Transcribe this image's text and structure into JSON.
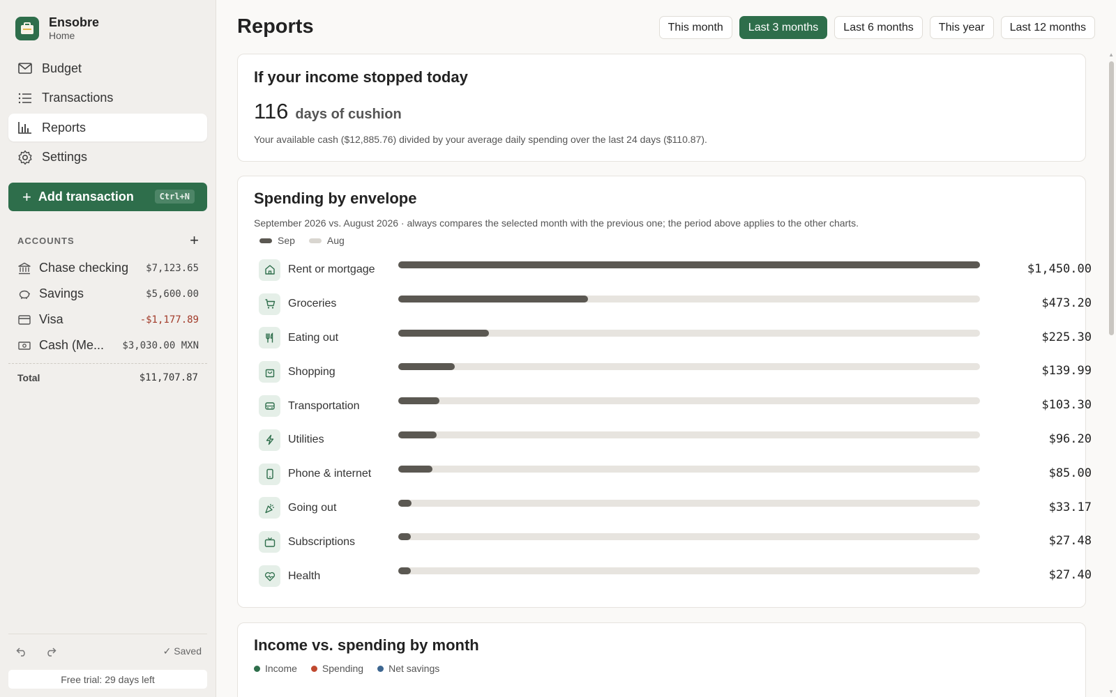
{
  "app": {
    "name": "Ensobre",
    "subtitle": "Home"
  },
  "nav": [
    {
      "label": "Budget",
      "icon": "envelope-icon",
      "active": false
    },
    {
      "label": "Transactions",
      "icon": "list-icon",
      "active": false
    },
    {
      "label": "Reports",
      "icon": "bar-chart-icon",
      "active": true
    },
    {
      "label": "Settings",
      "icon": "gear-icon",
      "active": false
    }
  ],
  "add_transaction": {
    "label": "Add transaction",
    "shortcut": "Ctrl+N"
  },
  "accounts": {
    "title": "ACCOUNTS",
    "items": [
      {
        "name": "Chase checking",
        "value": "$7,123.65",
        "icon": "bank-icon",
        "negative": false
      },
      {
        "name": "Savings",
        "value": "$5,600.00",
        "icon": "piggy-bank-icon",
        "negative": false
      },
      {
        "name": "Visa",
        "value": "-$1,177.89",
        "icon": "credit-card-icon",
        "negative": true
      },
      {
        "name": "Cash (Me...",
        "value": "$3,030.00 MXN",
        "icon": "cash-icon",
        "negative": false
      }
    ],
    "total_label": "Total",
    "total_value": "$11,707.87"
  },
  "footer": {
    "saved": "✓ Saved",
    "trial": "Free trial: 29 days left"
  },
  "page": {
    "title": "Reports"
  },
  "ranges": [
    {
      "label": "This month",
      "active": false
    },
    {
      "label": "Last 3 months",
      "active": true
    },
    {
      "label": "Last 6 months",
      "active": false
    },
    {
      "label": "This year",
      "active": false
    },
    {
      "label": "Last 12 months",
      "active": false
    }
  ],
  "cushion": {
    "title": "If your income stopped today",
    "days": "116",
    "days_label": "days of cushion",
    "note": "Your available cash ($12,885.76) divided by your average daily spending over the last 24 days ($110.87)."
  },
  "spending": {
    "title": "Spending by envelope",
    "subtitle": "September 2026 vs. August 2026 · always compares the selected month with the previous one; the period above applies to the other charts.",
    "legend": [
      {
        "label": "Sep",
        "color": "#5b5852"
      },
      {
        "label": "Aug",
        "color": "#d9d6d0"
      }
    ],
    "envelopes": [
      {
        "name": "Rent or mortgage",
        "amount": "$1,450.00",
        "value": 1450.0,
        "icon": "home-icon"
      },
      {
        "name": "Groceries",
        "amount": "$473.20",
        "value": 473.2,
        "icon": "cart-icon"
      },
      {
        "name": "Eating out",
        "amount": "$225.30",
        "value": 225.3,
        "icon": "utensils-icon"
      },
      {
        "name": "Shopping",
        "amount": "$139.99",
        "value": 139.99,
        "icon": "shopping-bag-icon"
      },
      {
        "name": "Transportation",
        "amount": "$103.30",
        "value": 103.3,
        "icon": "bus-icon"
      },
      {
        "name": "Utilities",
        "amount": "$96.20",
        "value": 96.2,
        "icon": "bolt-icon"
      },
      {
        "name": "Phone & internet",
        "amount": "$85.00",
        "value": 85.0,
        "icon": "phone-icon"
      },
      {
        "name": "Going out",
        "amount": "$33.17",
        "value": 33.17,
        "icon": "party-icon"
      },
      {
        "name": "Subscriptions",
        "amount": "$27.48",
        "value": 27.48,
        "icon": "tv-icon"
      },
      {
        "name": "Health",
        "amount": "$27.40",
        "value": 27.4,
        "icon": "heart-pulse-icon"
      }
    ],
    "max": 1450.0
  },
  "income_chart": {
    "title": "Income vs. spending by month",
    "legend": [
      {
        "label": "Income",
        "color": "#2e6e4b"
      },
      {
        "label": "Spending",
        "color": "#c0492f"
      },
      {
        "label": "Net savings",
        "color": "#3d6690"
      }
    ]
  }
}
